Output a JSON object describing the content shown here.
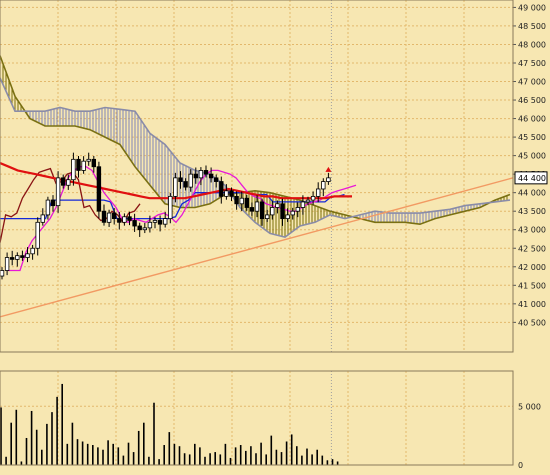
{
  "chart_data": [
    {
      "type": "candlestick",
      "title": "",
      "ylim": [
        39700,
        49200
      ],
      "y_ticks": [
        {
          "value": 49000,
          "label": "49 000"
        },
        {
          "value": 48500,
          "label": "48 500"
        },
        {
          "value": 48000,
          "label": "48 000"
        },
        {
          "value": 47500,
          "label": "47 500"
        },
        {
          "value": 47000,
          "label": "47 000"
        },
        {
          "value": 46500,
          "label": "46 500"
        },
        {
          "value": 46000,
          "label": "46 000"
        },
        {
          "value": 45500,
          "label": "45 500"
        },
        {
          "value": 45000,
          "label": "45 000"
        },
        {
          "value": 44500,
          "label": "44 500"
        },
        {
          "value": 44000,
          "label": "44 000"
        },
        {
          "value": 43500,
          "label": "43 500"
        },
        {
          "value": 43000,
          "label": "43 000"
        },
        {
          "value": 42500,
          "label": "42 500"
        },
        {
          "value": 42000,
          "label": "42 000"
        },
        {
          "value": 41500,
          "label": "41 500"
        },
        {
          "value": 41000,
          "label": "41 000"
        },
        {
          "value": 40500,
          "label": "40 500"
        }
      ],
      "last_price_label": "44 400",
      "last_price": 44400,
      "grid": true,
      "colors": {
        "background": "#f7e7b2",
        "grid": "#e3b86c",
        "cloud_bull": "#857a1a",
        "cloud_bear": "#8a8fb8",
        "ema_red": "#e01010",
        "kijun_blue": "#1428d8",
        "tenkan_magenta": "#e818d8",
        "chikou_brown": "#8a1414",
        "trendline": "#f29a63",
        "candle": "#000000"
      },
      "series": {
        "closes": [
          41900,
          42250,
          42200,
          42300,
          42250,
          42350,
          42500,
          43200,
          43400,
          43800,
          43650,
          44400,
          44200,
          44350,
          44900,
          44600,
          44850,
          44900,
          44700,
          43500,
          43200,
          43450,
          43300,
          43200,
          43350,
          43250,
          43100,
          43000,
          43050,
          43200,
          43250,
          43150,
          43300,
          43900,
          44400,
          44300,
          44150,
          44500,
          44400,
          44600,
          44500,
          44400,
          44300,
          43900,
          44050,
          43900,
          43700,
          43850,
          43600,
          43500,
          43750,
          43300,
          43400,
          43600,
          43700,
          43300,
          43400,
          43500,
          43600,
          43750,
          43800,
          43900,
          44100,
          44300,
          44400
        ],
        "tenkan": [
          41900,
          41900,
          41900,
          42400,
          42700,
          42900,
          43100,
          43300,
          43600,
          44000,
          44400,
          44600,
          44700,
          44700,
          44600,
          44300,
          44000,
          43800,
          43600,
          43300,
          43200,
          43300,
          43250,
          43200,
          43300,
          43400,
          43450,
          43350,
          43200,
          43400,
          43700,
          44000,
          44300,
          44500,
          44600,
          44600,
          44550,
          44500,
          44400,
          44200,
          44000,
          43900,
          43850,
          43700,
          43650,
          43600,
          43550,
          43500,
          43500,
          43600,
          43700,
          43750,
          43800,
          43900,
          44000,
          44050,
          44100,
          44150,
          44200
        ],
        "kijun": [
          43300,
          43300,
          43300,
          43300,
          43300,
          43300,
          43300,
          43300,
          43800,
          43800,
          43800,
          43800,
          43800,
          43800,
          43800,
          43800,
          43800,
          43750,
          43300,
          43300,
          43300,
          43300,
          43300,
          43300,
          43300,
          43300,
          43300,
          43350,
          43700,
          43800,
          44000,
          44000,
          44000,
          44000,
          44000,
          44000,
          44000,
          44000,
          44000,
          43950,
          43950,
          43950,
          43750,
          43750,
          43750,
          43750,
          43750,
          43750,
          43750,
          43750,
          43750,
          43900,
          43900,
          43950
        ],
        "ema": [
          44800,
          44700,
          44600,
          44550,
          44500,
          44450,
          44400,
          44350,
          44300,
          44250,
          44200,
          44150,
          44100,
          44050,
          44000,
          43950,
          43900,
          43850,
          43850,
          43850,
          43850,
          43850,
          43900,
          43950,
          44000,
          44050,
          44100,
          44050,
          44000,
          43950,
          43900,
          43900,
          43850,
          43850,
          43850,
          43850,
          43850,
          43850,
          43900,
          43900,
          43900
        ],
        "chikou": [
          42650,
          43400,
          43350,
          43450,
          43850,
          44100,
          44350,
          44550,
          44600,
          44650,
          44250,
          44300,
          44500,
          44550,
          44350,
          43600,
          43650,
          43400,
          43250,
          43300,
          43500,
          43400,
          43200,
          43450,
          43500,
          43700
        ],
        "senkou_a": [
          47700,
          46600,
          46000,
          45800,
          45800,
          45800,
          45700,
          45500,
          45300,
          44700,
          44200,
          43700,
          43600,
          43600,
          43700,
          43950,
          44000,
          44050,
          44000,
          43900,
          43800,
          43650,
          43500,
          43400,
          43300,
          43200,
          43200,
          43200,
          43150,
          43300,
          43400,
          43500,
          43600,
          43800,
          43950
        ],
        "senkou_b": [
          47100,
          46200,
          46200,
          46200,
          46300,
          46200,
          46200,
          46300,
          46250,
          46200,
          45600,
          45300,
          44800,
          44600,
          44500,
          44200,
          43600,
          43200,
          42900,
          42800,
          43100,
          43200,
          43400,
          43300,
          43400,
          43500,
          43450,
          43450,
          43450,
          43500,
          43550,
          43650,
          43700,
          43750,
          43800
        ],
        "volume": [
          4900,
          700,
          3600,
          4700,
          300,
          2300,
          4600,
          3000,
          1300,
          3500,
          4500,
          5800,
          6900,
          1800,
          3600,
          2200,
          2000,
          1800,
          1700,
          1500,
          1300,
          2100,
          1800,
          1500,
          800,
          1900,
          1100,
          2900,
          3600,
          700,
          5300,
          500,
          1700,
          2800,
          1800,
          1600,
          1000,
          900,
          1800,
          1500,
          700,
          1000,
          1100,
          900,
          1800,
          600,
          1500,
          1700,
          1200,
          1600,
          1000,
          1900,
          900,
          2500,
          1300,
          1100,
          2000,
          2600,
          1600,
          800,
          1400,
          900,
          1300,
          800,
          400,
          500,
          300
        ],
        "trendline": {
          "start": 40650,
          "end": 44400
        }
      }
    },
    {
      "type": "bar",
      "title": "volume",
      "ylim": [
        0,
        8000
      ],
      "y_ticks": [
        {
          "value": 5000,
          "label": "5 000"
        },
        {
          "value": 0,
          "label": "0"
        }
      ]
    }
  ]
}
